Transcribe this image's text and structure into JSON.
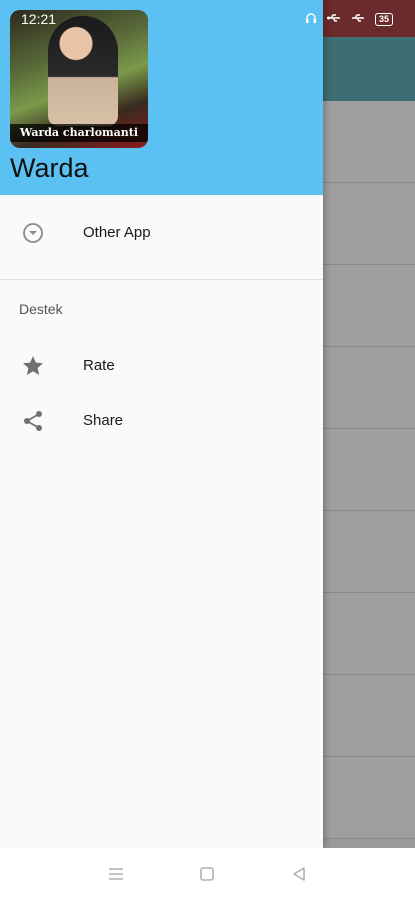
{
  "status_bar": {
    "time": "12:21",
    "battery": "35"
  },
  "drawer": {
    "header": {
      "image_caption": "Warda charlomanti",
      "title": "Warda"
    },
    "items": [
      {
        "label": "Other App",
        "icon": "expand-circle-icon"
      }
    ],
    "section": {
      "label": "Destek",
      "items": [
        {
          "label": "Rate",
          "icon": "star-icon"
        },
        {
          "label": "Share",
          "icon": "share-icon"
        }
      ]
    }
  },
  "nav_bar": {
    "buttons": [
      "menu-icon",
      "home-icon",
      "back-icon"
    ]
  },
  "colors": {
    "header": "#5bc1f3",
    "drawer_bg": "#fafafa",
    "icon": "#707070"
  }
}
